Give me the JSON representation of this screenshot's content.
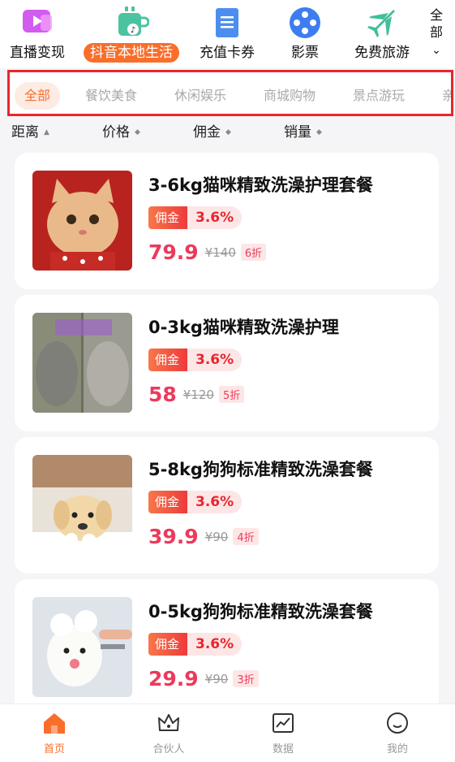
{
  "categories": [
    {
      "label": "直播变现",
      "icon": "live-video-icon",
      "color": "#d25bf0"
    },
    {
      "label": "抖音本地生活",
      "icon": "coffee-cup-icon",
      "color": "#4cc3a0",
      "active": true
    },
    {
      "label": "充值卡券",
      "icon": "ticket-icon",
      "color": "#4c8ef0"
    },
    {
      "label": "影票",
      "icon": "film-reel-icon",
      "color": "#3d7df0"
    },
    {
      "label": "免费旅游",
      "icon": "airplane-icon",
      "color": "#3fbf9b"
    }
  ],
  "all_toggle": {
    "label_line1": "全",
    "label_line2": "部",
    "chevron": "⌄"
  },
  "subtabs": [
    "全部",
    "餐饮美食",
    "休闲娱乐",
    "商城购物",
    "景点游玩",
    "亲"
  ],
  "sort": [
    "距离",
    "价格",
    "佣金",
    "销量"
  ],
  "commission_label": "佣金",
  "products": [
    {
      "name": "3-6kg猫咪精致洗澡护理套餐",
      "rate": "3.6%",
      "price": "79.9",
      "original": "¥140",
      "discount": "6折",
      "image": "cat-christmas-photo"
    },
    {
      "name": "0-3kg猫咪精致洗澡护理",
      "rate": "3.6%",
      "price": "58",
      "original": "¥120",
      "discount": "5折",
      "image": "cat-before-after-photo"
    },
    {
      "name": "5-8kg狗狗标准精致洗澡套餐",
      "rate": "3.6%",
      "price": "39.9",
      "original": "¥90",
      "discount": "4折",
      "image": "dog-bath-photo"
    },
    {
      "name": "0-5kg狗狗标准精致洗澡套餐",
      "rate": "3.6%",
      "price": "29.9",
      "original": "¥90",
      "discount": "3折",
      "image": "white-dog-bath-photo"
    }
  ],
  "bottom_nav": [
    {
      "label": "首页",
      "icon": "home-icon",
      "active": true
    },
    {
      "label": "合伙人",
      "icon": "crown-icon"
    },
    {
      "label": "数据",
      "icon": "chart-icon"
    },
    {
      "label": "我的",
      "icon": "smiley-icon"
    }
  ],
  "colors": {
    "accent": "#f96e2b",
    "price": "#ec3a5c",
    "highlight_border": "#e8262e"
  }
}
